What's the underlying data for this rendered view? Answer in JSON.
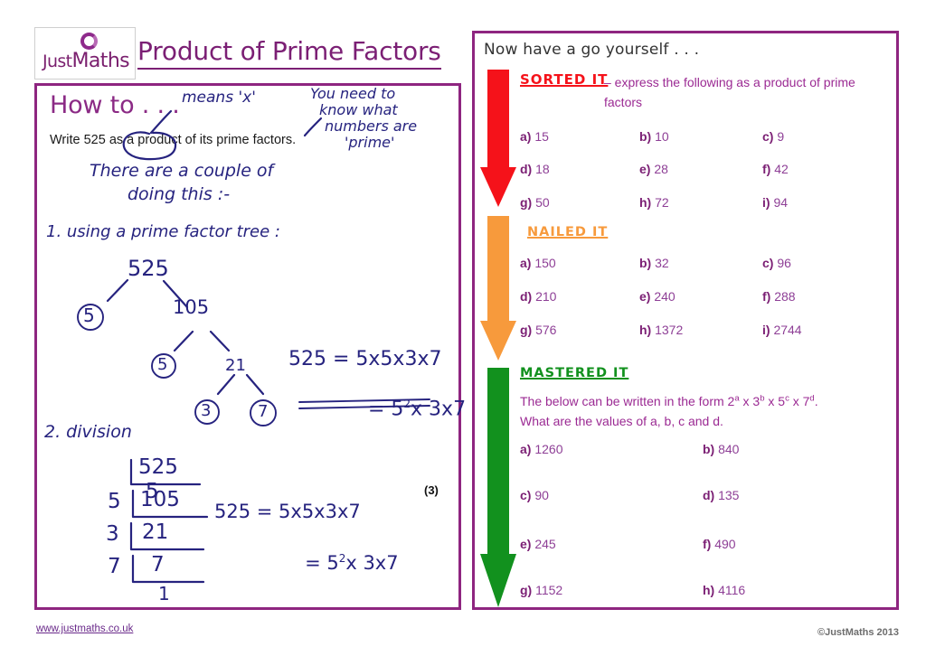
{
  "logo": {
    "text_just": "Just",
    "text_maths": "Maths",
    "full": "JustMaths"
  },
  "header": {
    "title": "Product of Prime Factors"
  },
  "left_panel": {
    "howto_label": "How to . . .",
    "prompt": "Write 525 as a product of its prime factors.",
    "marks": "(3)",
    "annotations": {
      "means_times": "means 'x'",
      "need_to_know_1": "You need to",
      "need_to_know_2": "know what",
      "need_to_know_3": "numbers are",
      "need_to_know_4": "'prime'",
      "couple_ways_1": "There are a couple of",
      "couple_ways_2": "doing this :-",
      "method1": "1. using a prime factor tree :",
      "method2": "2. division"
    },
    "factor_tree": {
      "root": "525",
      "level1_left": "5",
      "level1_right": "105",
      "level2_left": "5",
      "level2_right": "21",
      "level3_left": "3",
      "level3_right": "7"
    },
    "tree_result": {
      "line1": "525 = 5x5x3x7",
      "line2": "= 5",
      "line2_sup": "2",
      "line2_rest": "x 3x7"
    },
    "division_ladder": {
      "rows": [
        {
          "divisor": "5",
          "dividend": "525"
        },
        {
          "divisor": "5",
          "dividend": "105"
        },
        {
          "divisor": "3",
          "dividend": "21"
        },
        {
          "divisor": "7",
          "dividend": "7"
        }
      ],
      "remainder": "1"
    },
    "division_result": {
      "line1": "525 = 5x5x3x7",
      "line2": "= 5",
      "line2_sup": "2",
      "line2_rest": "x 3x7"
    }
  },
  "right_panel": {
    "intro": "Now have a go yourself . . .",
    "sections": [
      {
        "badge": "SORTED IT",
        "badge_color": "#f5121a",
        "arrow_color": "#f5121a",
        "description": "– express the following as a product of prime factors",
        "questions": [
          {
            "label": "a)",
            "value": "15"
          },
          {
            "label": "b)",
            "value": "10"
          },
          {
            "label": "c)",
            "value": "9"
          },
          {
            "label": "d)",
            "value": "18"
          },
          {
            "label": "e)",
            "value": "28"
          },
          {
            "label": "f)",
            "value": "42"
          },
          {
            "label": "g)",
            "value": "50"
          },
          {
            "label": "h)",
            "value": "72"
          },
          {
            "label": "i)",
            "value": "94"
          }
        ]
      },
      {
        "badge": "NAILED IT",
        "badge_color": "#f79a3c",
        "arrow_color": "#f79a3c",
        "description": "",
        "questions": [
          {
            "label": "a)",
            "value": "150"
          },
          {
            "label": "b)",
            "value": "32"
          },
          {
            "label": "c)",
            "value": "96"
          },
          {
            "label": "d)",
            "value": "210"
          },
          {
            "label": "e)",
            "value": "240"
          },
          {
            "label": "f)",
            "value": "288"
          },
          {
            "label": "g)",
            "value": "576"
          },
          {
            "label": "h)",
            "value": "1372"
          },
          {
            "label": "i)",
            "value": "2744"
          }
        ]
      },
      {
        "badge": "MASTERED IT",
        "badge_color": "#12911e",
        "arrow_color": "#12911e",
        "description_line1": "The below can be written in the form 2",
        "description_parts": {
          "a": "a",
          "b": "b",
          "c": "c",
          "d": "d",
          "seg1": "The below can be written in the form 2",
          "seg2": " x 3",
          "seg3": " x 5",
          "seg4": " x 7",
          "seg5": ".",
          "line2": "What are the values of a, b, c and d."
        },
        "questions": [
          {
            "label": "a)",
            "value": "1260"
          },
          {
            "label": "b)",
            "value": "840"
          },
          {
            "label": "c)",
            "value": "90"
          },
          {
            "label": "d)",
            "value": "135"
          },
          {
            "label": "e)",
            "value": "245"
          },
          {
            "label": "f)",
            "value": "490"
          },
          {
            "label": "g)",
            "value": "1152"
          },
          {
            "label": "h)",
            "value": "4116"
          }
        ]
      }
    ]
  },
  "footer": {
    "url": "www.justmaths.co.uk",
    "copyright": "©JustMaths 2013"
  },
  "colors": {
    "purple": "#8e2580",
    "title_purple": "#7b1f74",
    "ink_blue": "#26237f",
    "red": "#f5121a",
    "orange": "#f79a3c",
    "green": "#12911e",
    "question_purple": "#8e3f96"
  }
}
